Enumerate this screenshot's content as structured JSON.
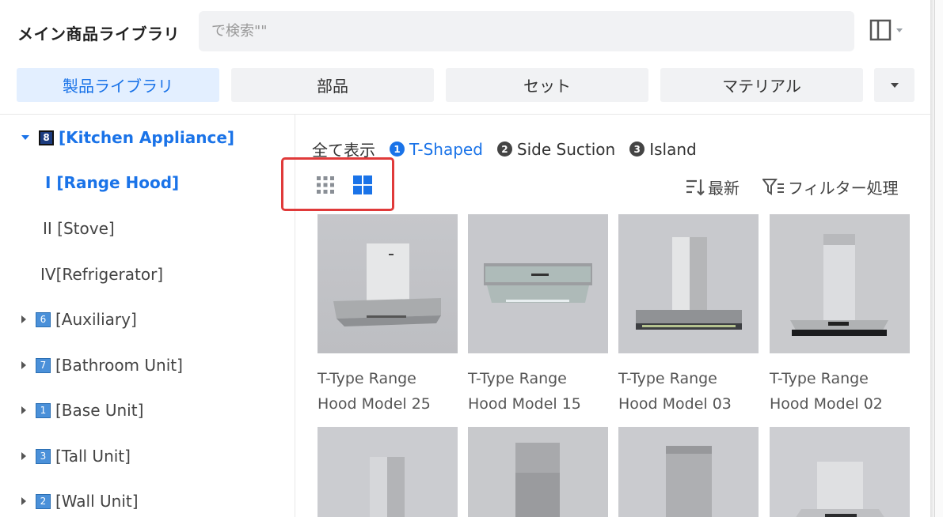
{
  "header": {
    "title": "メイン商品ライブラリ",
    "search_placeholder": "で検索\"\""
  },
  "tabs": [
    {
      "label": "製品ライブラリ",
      "active": true
    },
    {
      "label": "部品",
      "active": false
    },
    {
      "label": "セット",
      "active": false
    },
    {
      "label": "マテリアル",
      "active": false
    }
  ],
  "tree": {
    "kitchen": {
      "badge": "8",
      "label": "[Kitchen Appliance]"
    },
    "range_hood": {
      "label": "Ⅰ [Range Hood]"
    },
    "stove": {
      "label": "II [Stove]"
    },
    "refrigerator": {
      "label": "IV[Refrigerator]"
    },
    "auxiliary": {
      "badge": "6",
      "label": "[Auxiliary]"
    },
    "bathroom": {
      "badge": "7",
      "label": "[Bathroom Unit]"
    },
    "base": {
      "badge": "1",
      "label": "[Base Unit]"
    },
    "tall": {
      "badge": "3",
      "label": "[Tall Unit]"
    },
    "wall": {
      "badge": "2",
      "label": "[Wall Unit]"
    }
  },
  "filters": {
    "all": "全て表示",
    "chips": [
      {
        "num": "1",
        "label": "T-Shaped",
        "active": true
      },
      {
        "num": "2",
        "label": "Side Suction",
        "active": false
      },
      {
        "num": "3",
        "label": "Island",
        "active": false
      }
    ]
  },
  "toolbar": {
    "sort_label": "最新",
    "filter_label": "フィルター処理"
  },
  "products": [
    {
      "name_line1": "T-Type Range",
      "name_line2": "Hood Model 25"
    },
    {
      "name_line1": "T-Type Range",
      "name_line2": "Hood Model 15"
    },
    {
      "name_line1": "T-Type Range",
      "name_line2": "Hood Model 03"
    },
    {
      "name_line1": "T-Type Range",
      "name_line2": "Hood Model 02"
    }
  ],
  "colors": {
    "accent": "#1a73e8",
    "highlight_box": "#e03a3a",
    "tab_bg": "#f1f2f4",
    "active_tab_bg": "#e3efff"
  }
}
